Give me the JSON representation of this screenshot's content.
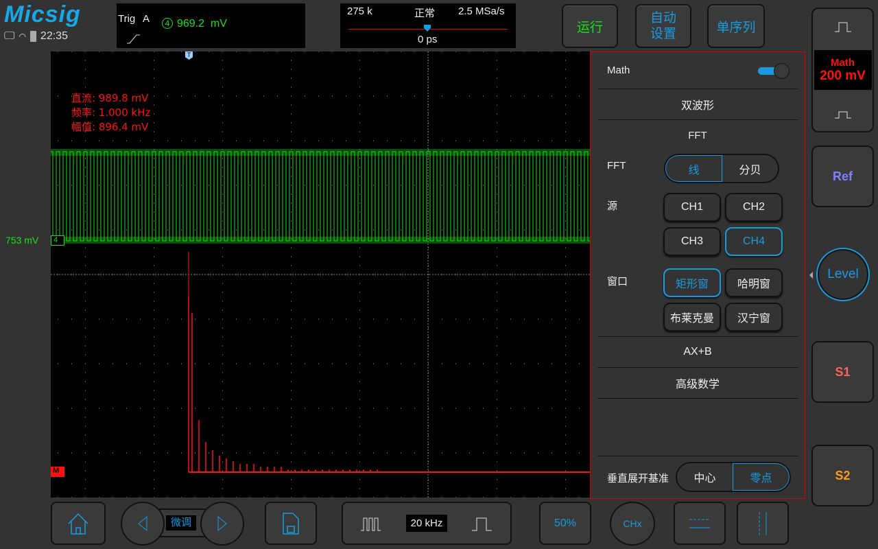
{
  "header": {
    "logo": "Micsig",
    "time": "22:35",
    "status_icons": [
      "monitor-icon",
      "wifi-icon",
      "battery-icon"
    ]
  },
  "trigger": {
    "label": "Trig",
    "mode": "A",
    "channel": "4",
    "level": "969.2  mV",
    "edge": "rising-edge-icon"
  },
  "timebase": {
    "memory": "275 k",
    "acq_mode": "正常",
    "sample_rate": "2.5 MSa/s",
    "position": "0 ps"
  },
  "top_buttons": {
    "run": "运行",
    "auto_line1": "自动",
    "auto_line2": "设置",
    "single": "单序列"
  },
  "measurements": [
    "直流: 989.8 mV",
    "频率: 1.000 kHz",
    "幅值: 896.4 mV"
  ],
  "ch4": {
    "offset_label": "753 mV",
    "marker": "4",
    "color": "#19e019"
  },
  "math": {
    "marker": "M",
    "color": "#ff1010",
    "scale": "200 mV",
    "label": "Math",
    "spectrum_mV": [
      788,
      714,
      234,
      135,
      98,
      74,
      62,
      49,
      37,
      37,
      37,
      25,
      25,
      25,
      25,
      12,
      12,
      12,
      12,
      12,
      12,
      12,
      12,
      12,
      12,
      12,
      12,
      12,
      12
    ]
  },
  "panel": {
    "math_label": "Math",
    "math_enabled": true,
    "dual": "双波形",
    "fft_title": "FFT",
    "fft_label": "FFT",
    "fft_linear": "线",
    "fft_db": "分贝",
    "source_label": "源",
    "sources": [
      "CH1",
      "CH2",
      "CH3",
      "CH4"
    ],
    "source_selected": "CH4",
    "window_label": "窗口",
    "windows": [
      "矩形窗",
      "哈明窗",
      "布莱克曼",
      "汉宁窗"
    ],
    "window_selected": "矩形窗",
    "axb": "AX+B",
    "advanced": "高级数学",
    "vert_ref_label": "垂直展开基准",
    "vert_center": "中心",
    "vert_zero": "零点",
    "vert_selected": "零点"
  },
  "side": {
    "ref": "Ref",
    "level": "Level",
    "s1": "S1",
    "s2": "S2"
  },
  "bottom": {
    "fine": "微调",
    "freq": "20 kHz",
    "fifty": "50%",
    "chx": "CHx"
  },
  "colors": {
    "accent": "#1a9be0",
    "ch4": "#19e019",
    "math": "#ff1010",
    "s1": "#ff6060",
    "s2": "#ff9a1a",
    "ref": "#8080ff"
  }
}
